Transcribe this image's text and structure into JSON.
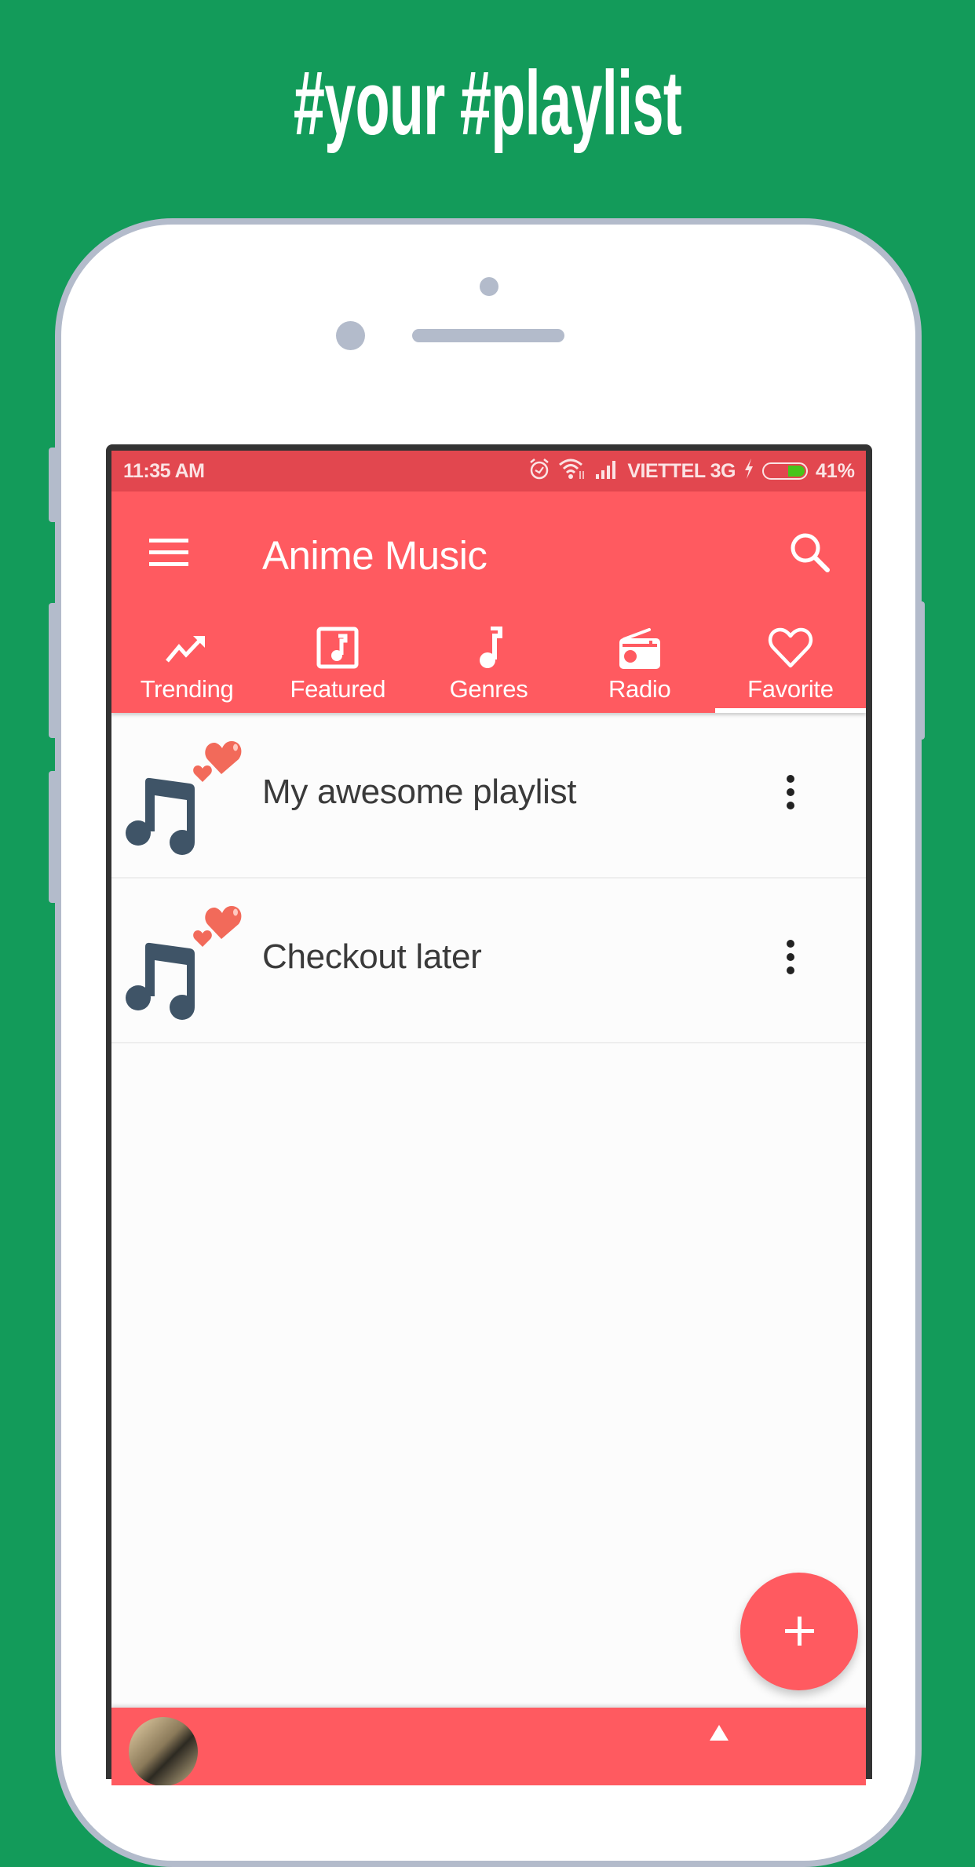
{
  "promo": {
    "headline": "#your #playlist",
    "background_color": "#139B5A"
  },
  "status_bar": {
    "time": "11:35 AM",
    "carrier": "VIETTEL 3G",
    "battery_percent_label": "41%",
    "battery_level": 0.41,
    "icons": [
      "alarm-icon",
      "wifi-icon",
      "signal-icon",
      "charging-bolt-icon",
      "battery-icon"
    ]
  },
  "app": {
    "title": "Anime Music",
    "accent_color": "#FF5A60",
    "status_bar_color": "#E2474F",
    "menu_icon": "hamburger-menu-icon",
    "search_icon": "search-icon"
  },
  "tabs": [
    {
      "label": "Trending",
      "icon": "trending-up-icon",
      "selected": false
    },
    {
      "label": "Featured",
      "icon": "featured-album-icon",
      "selected": false
    },
    {
      "label": "Genres",
      "icon": "music-note-icon",
      "selected": false
    },
    {
      "label": "Radio",
      "icon": "radio-icon",
      "selected": false
    },
    {
      "label": "Favorite",
      "icon": "heart-outline-icon",
      "selected": true
    }
  ],
  "playlists": [
    {
      "name": "My awesome playlist",
      "icon": "music-note-hearts-icon",
      "menu_icon": "more-vertical-icon"
    },
    {
      "name": "Checkout later",
      "icon": "music-note-hearts-icon",
      "menu_icon": "more-vertical-icon"
    }
  ],
  "fab": {
    "icon": "plus-icon",
    "label": "+"
  },
  "mini_player": {
    "cover_icon": "album-cover",
    "control_icon": "play-icon"
  }
}
